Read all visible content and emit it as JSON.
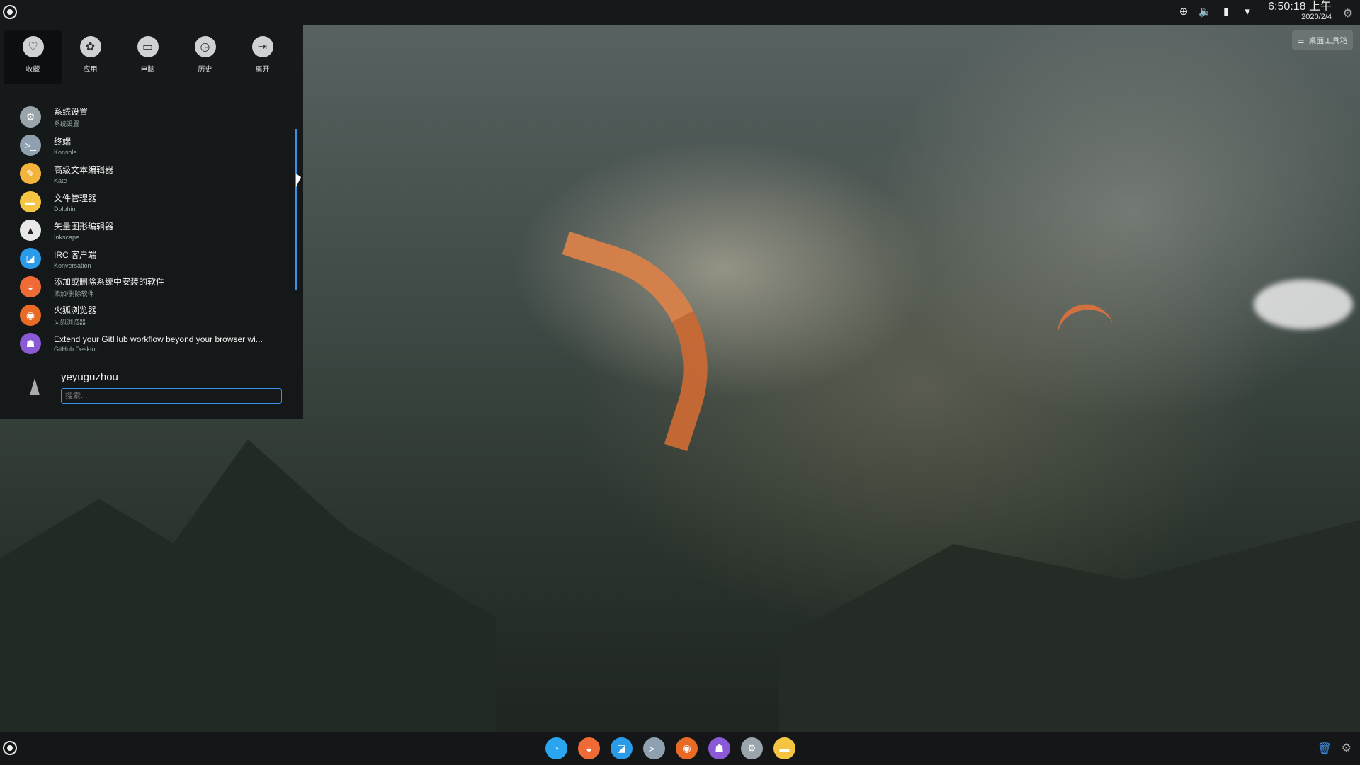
{
  "colors": {
    "accent": "#3d8ee9",
    "panel": "#161819",
    "menu_bg": "#141718"
  },
  "top_panel": {
    "clock_time": "6:50:18 上午",
    "clock_date": "2020/2/4",
    "tray_icons": [
      "network-icon",
      "volume-icon",
      "clipboard-icon",
      "expand-arrow-icon"
    ]
  },
  "desktop_toolbox": {
    "label": "桌面工具箱"
  },
  "launcher": {
    "categories": [
      {
        "label": "收藏",
        "icon": "heart-icon"
      },
      {
        "label": "应用",
        "icon": "apps-icon"
      },
      {
        "label": "电脑",
        "icon": "computer-icon"
      },
      {
        "label": "历史",
        "icon": "history-icon"
      },
      {
        "label": "离开",
        "icon": "leave-icon"
      }
    ],
    "apps": [
      {
        "name": "系统设置",
        "desc": "系统设置",
        "icon": "system-settings-icon",
        "color": "#9aa4ab"
      },
      {
        "name": "终端",
        "desc": "Konsole",
        "icon": "terminal-icon",
        "color": "#8fa1b0"
      },
      {
        "name": "高级文本编辑器",
        "desc": "Kate",
        "icon": "text-editor-icon",
        "color": "#f2b43a"
      },
      {
        "name": "文件管理器",
        "desc": "Dolphin",
        "icon": "file-manager-icon",
        "color": "#f5c542"
      },
      {
        "name": "矢量图形编辑器",
        "desc": "Inkscape",
        "icon": "inkscape-icon",
        "color": "#e8e8e8"
      },
      {
        "name": "IRC 客户端",
        "desc": "Konversation",
        "icon": "irc-icon",
        "color": "#2a9be8"
      },
      {
        "name": "添加或删除系统中安装的软件",
        "desc": "添加/删除软件",
        "icon": "software-center-icon",
        "color": "#f06a35"
      },
      {
        "name": "火狐浏览器",
        "desc": "火狐浏览器",
        "icon": "firefox-icon",
        "color": "#e86a24"
      },
      {
        "name": "Extend your GitHub workflow beyond your browser wi...",
        "desc": "GitHub Desktop",
        "icon": "github-icon",
        "color": "#8a5ad6"
      }
    ],
    "user": {
      "name": "yeyuguzhou"
    },
    "search": {
      "placeholder": "搜索..."
    }
  },
  "dock": {
    "apps": [
      {
        "name": "qq",
        "icon": "qq-icon",
        "color": "#2aa6f0"
      },
      {
        "name": "software-center",
        "icon": "software-center-icon",
        "color": "#f06a35"
      },
      {
        "name": "irc",
        "icon": "irc-icon",
        "color": "#2a9be8"
      },
      {
        "name": "terminal",
        "icon": "terminal-icon",
        "color": "#8fa1b0"
      },
      {
        "name": "firefox",
        "icon": "firefox-icon",
        "color": "#e86a24"
      },
      {
        "name": "github",
        "icon": "github-icon",
        "color": "#8a5ad6"
      },
      {
        "name": "system-settings",
        "icon": "system-settings-icon",
        "color": "#9aa4ab"
      },
      {
        "name": "file-manager",
        "icon": "file-manager-icon",
        "color": "#f5c542"
      }
    ]
  }
}
